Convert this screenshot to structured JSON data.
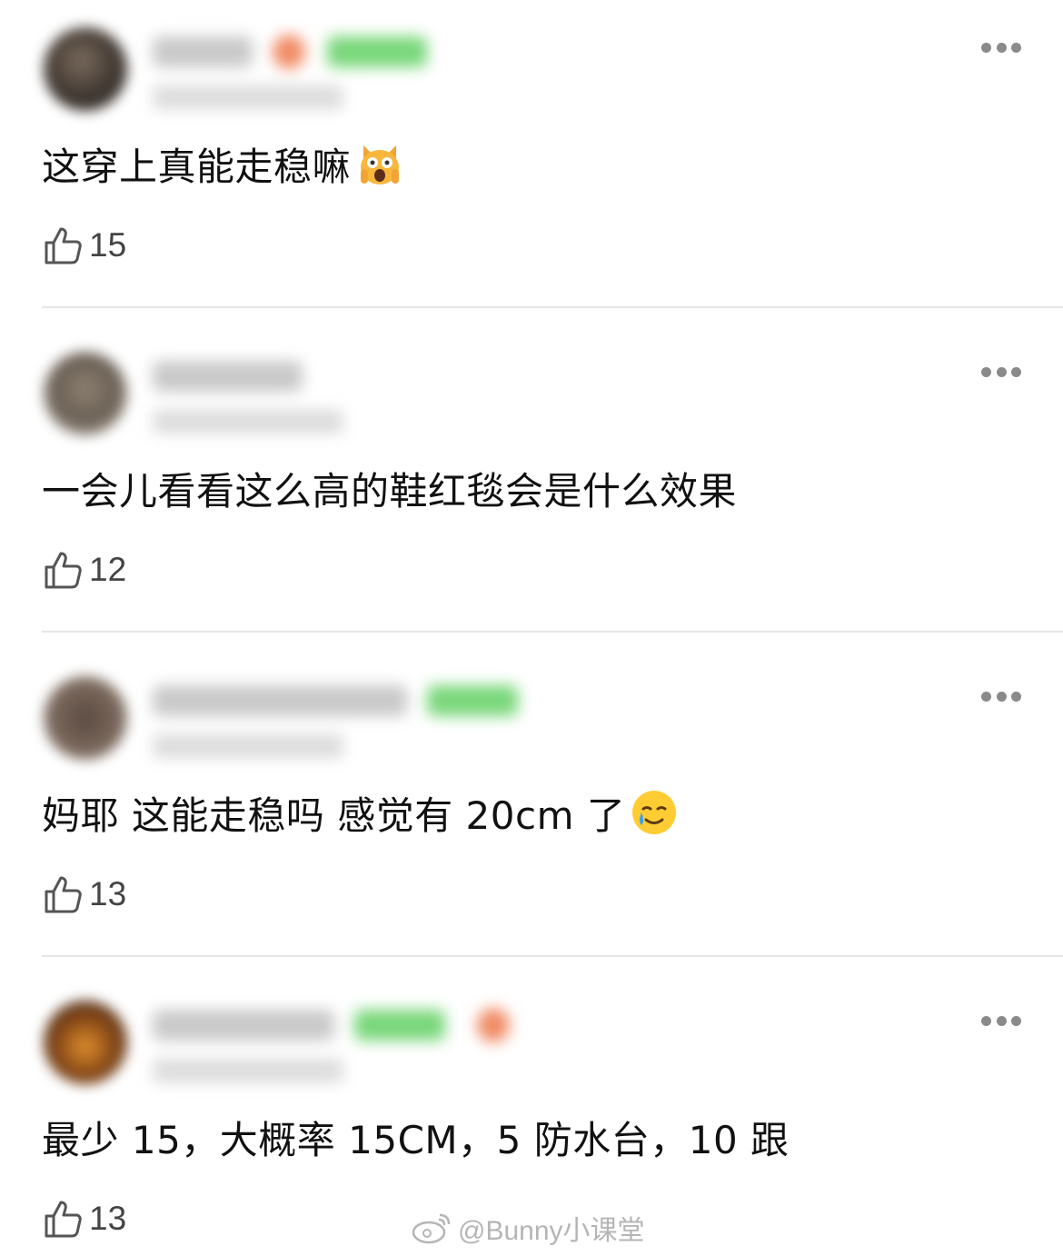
{
  "comments": [
    {
      "text": "这穿上真能走稳嘛",
      "emoji": "scream-cat-emoji",
      "likes": "15"
    },
    {
      "text": "一会儿看看这么高的鞋红毯会是什么效果",
      "emoji": "",
      "likes": "12"
    },
    {
      "text": "妈耶 这能走稳吗 感觉有 20cm 了",
      "emoji": "crying-smile-emoji",
      "likes": "13"
    },
    {
      "text": "最少 15，大概率 15CM，5 防水台，10 跟",
      "emoji": "",
      "likes": "13"
    }
  ],
  "icons": {
    "more": "more-dots-icon",
    "like": "thumbs-up-icon",
    "logo": "weibo-logo-icon"
  },
  "watermark": {
    "text": "@Bunny小课堂"
  },
  "colors": {
    "badge": "#79d77a",
    "divider": "#e6e6e6",
    "text": "#111111",
    "count": "#444444"
  }
}
